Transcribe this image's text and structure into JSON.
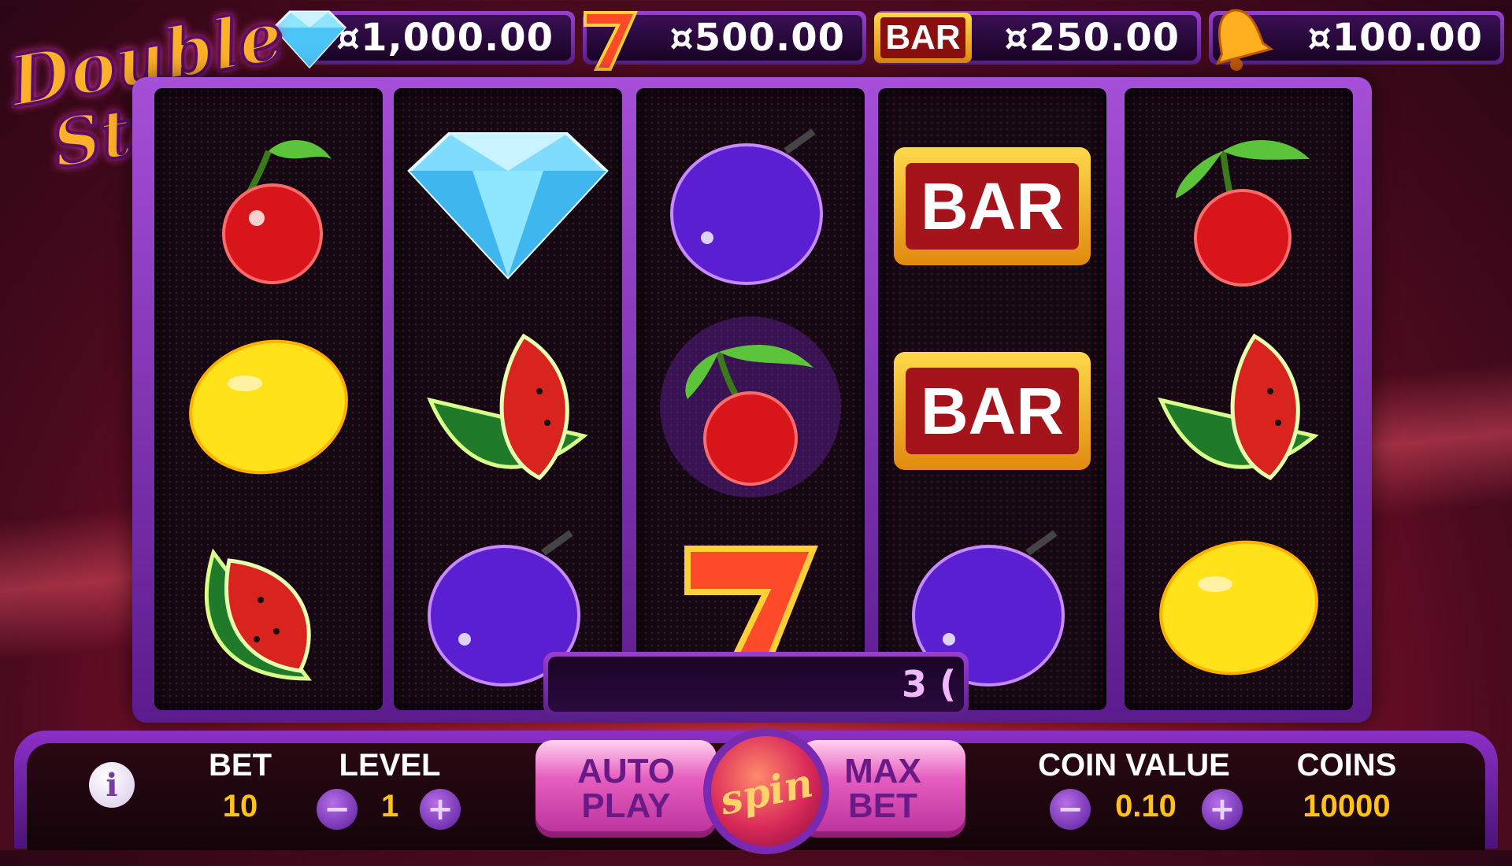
{
  "game": {
    "title_line1": "Double",
    "title_line2": "Stacks"
  },
  "jackpots": [
    {
      "icon": "diamond-icon",
      "value": "¤1,000.00"
    },
    {
      "icon": "seven-icon",
      "value": "¤500.00"
    },
    {
      "icon": "bar-icon",
      "value": "¤250.00"
    },
    {
      "icon": "bell-icon",
      "value": "¤100.00"
    }
  ],
  "reels": [
    [
      "cherry",
      "lemon",
      "watermelon"
    ],
    [
      "diamond",
      "watermelon",
      "plum"
    ],
    [
      "plum",
      "cherry",
      "seven"
    ],
    [
      "bar",
      "bar",
      "plum"
    ],
    [
      "cherry",
      "watermelon",
      "lemon"
    ]
  ],
  "bar_text": "BAR",
  "win_display": "3 (",
  "controls": {
    "bet_label": "BET",
    "bet_value": "10",
    "level_label": "LEVEL",
    "level_value": "1",
    "minus": "−",
    "plus": "+",
    "auto_line1": "AUTO",
    "auto_line2": "PLAY",
    "spin_label": "spin",
    "max_line1": "MAX",
    "max_line2": "BET",
    "coin_value_label": "COIN VALUE",
    "coin_value": "0.10",
    "coins_label": "COINS",
    "coins_value": "10000",
    "info": "i"
  },
  "colors": {
    "accent_purple": "#8c2fc7",
    "gold": "#ffc21a"
  }
}
